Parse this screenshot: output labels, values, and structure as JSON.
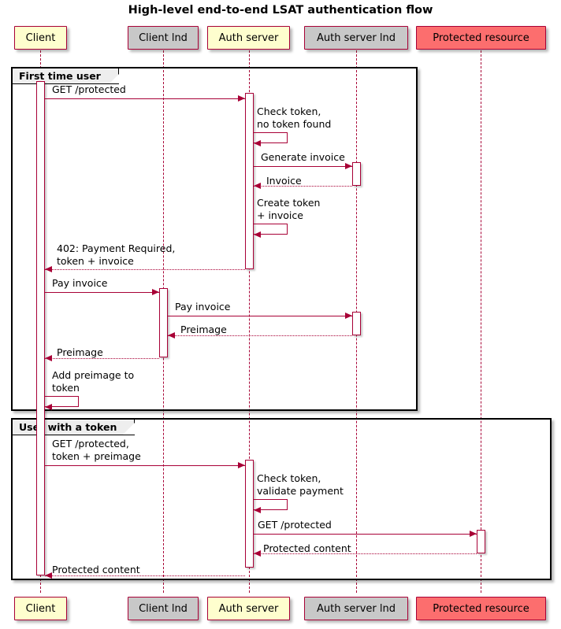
{
  "diagram": {
    "type": "uml-sequence-diagram",
    "title": "High-level end-to-end LSAT authentication flow",
    "colors": {
      "line": "#A80036",
      "participant_yellow": "#FEFECE",
      "participant_gray": "#C8C8C8",
      "participant_red": "#FC6E6E",
      "fragment_border": "#000000",
      "fragment_label_bg": "#EEEEEE"
    }
  },
  "participants": [
    {
      "id": "client",
      "label": "Client",
      "color": "yellow"
    },
    {
      "id": "client_lnd",
      "label": "Client lnd",
      "color": "gray"
    },
    {
      "id": "auth_server",
      "label": "Auth server",
      "color": "yellow"
    },
    {
      "id": "auth_server_lnd",
      "label": "Auth server lnd",
      "color": "gray"
    },
    {
      "id": "protected_resource",
      "label": "Protected resource",
      "color": "red"
    }
  ],
  "fragments": [
    {
      "id": "frag1",
      "label": "First time user"
    },
    {
      "id": "frag2",
      "label": "User with a token"
    }
  ],
  "messages": [
    {
      "id": "m1",
      "from": "client",
      "to": "auth_server",
      "label": "GET /protected",
      "style": "solid",
      "kind": "call"
    },
    {
      "id": "m2",
      "from": "auth_server",
      "to": "auth_server",
      "label": "Check token,\nno token found",
      "style": "solid",
      "kind": "self"
    },
    {
      "id": "m3",
      "from": "auth_server",
      "to": "auth_server_lnd",
      "label": "Generate invoice",
      "style": "solid",
      "kind": "call"
    },
    {
      "id": "m4",
      "from": "auth_server_lnd",
      "to": "auth_server",
      "label": "Invoice",
      "style": "dotted",
      "kind": "return"
    },
    {
      "id": "m5",
      "from": "auth_server",
      "to": "auth_server",
      "label": "Create token\n+ invoice",
      "style": "solid",
      "kind": "self"
    },
    {
      "id": "m6",
      "from": "auth_server",
      "to": "client",
      "label": "402: Payment Required,\ntoken + invoice",
      "style": "dotted",
      "kind": "return"
    },
    {
      "id": "m7",
      "from": "client",
      "to": "client_lnd",
      "label": "Pay invoice",
      "style": "solid",
      "kind": "call"
    },
    {
      "id": "m8",
      "from": "client_lnd",
      "to": "auth_server_lnd",
      "label": "Pay invoice",
      "style": "solid",
      "kind": "call"
    },
    {
      "id": "m9",
      "from": "auth_server_lnd",
      "to": "client_lnd",
      "label": "Preimage",
      "style": "dotted",
      "kind": "return"
    },
    {
      "id": "m10",
      "from": "client_lnd",
      "to": "client",
      "label": "Preimage",
      "style": "dotted",
      "kind": "return"
    },
    {
      "id": "m11",
      "from": "client",
      "to": "client",
      "label": "Add preimage to\ntoken",
      "style": "solid",
      "kind": "self"
    },
    {
      "id": "m12",
      "from": "client",
      "to": "auth_server",
      "label": "GET /protected,\ntoken + preimage",
      "style": "solid",
      "kind": "call"
    },
    {
      "id": "m13",
      "from": "auth_server",
      "to": "auth_server",
      "label": "Check token,\nvalidate payment",
      "style": "solid",
      "kind": "self"
    },
    {
      "id": "m14",
      "from": "auth_server",
      "to": "protected_resource",
      "label": "GET /protected",
      "style": "solid",
      "kind": "call"
    },
    {
      "id": "m15",
      "from": "protected_resource",
      "to": "auth_server",
      "label": "Protected content",
      "style": "dotted",
      "kind": "return"
    },
    {
      "id": "m16",
      "from": "auth_server",
      "to": "client",
      "label": "Protected content",
      "style": "dotted",
      "kind": "return"
    }
  ]
}
